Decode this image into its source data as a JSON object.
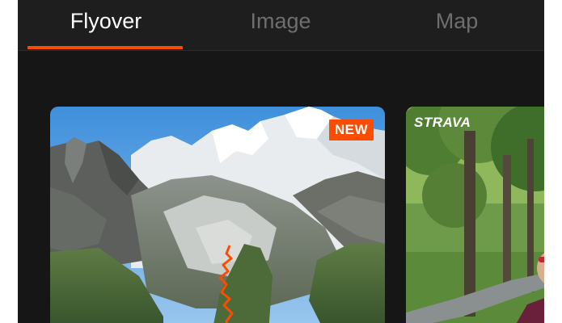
{
  "tabs": [
    {
      "label": "Flyover",
      "active": true
    },
    {
      "label": "Image",
      "active": false
    },
    {
      "label": "Map",
      "active": false
    }
  ],
  "accent_color": "#fc4c02",
  "cards": {
    "flyover": {
      "badge": "NEW",
      "image": "mountain-flyover-image"
    },
    "image": {
      "logo_text": "STRAVA",
      "image": "park-selfie-image"
    }
  }
}
